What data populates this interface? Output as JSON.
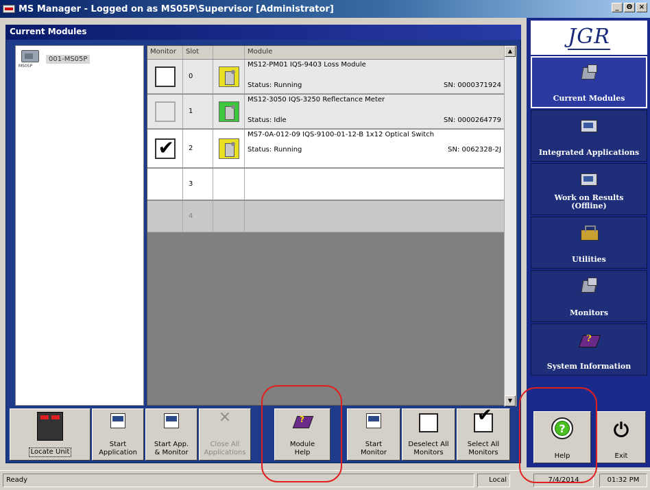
{
  "window": {
    "title": "MS Manager - Logged on as MS05P\\Supervisor [Administrator]",
    "btn_min": "_",
    "btn_max": "Θ",
    "btn_close": "×"
  },
  "panel": {
    "header": "Current Modules"
  },
  "tree": {
    "icon_caption": "MS05P",
    "node_label": "001-MS05P"
  },
  "grid": {
    "columns": [
      "Monitor",
      "Slot",
      "",
      "Module"
    ],
    "rows": [
      {
        "slot": "0",
        "checked": false,
        "module": "MS12-PM01 IQS-9403 Loss Module",
        "status": "Status: Running",
        "sn": "SN: 0000371924",
        "icon": "module-yellow-icon"
      },
      {
        "slot": "1",
        "checked": false,
        "module": "MS12-3050 IQS-3250 Reflectance Meter",
        "status": "Status: Idle",
        "sn": "SN: 0000264779",
        "icon": "module-green-icon"
      },
      {
        "slot": "2",
        "checked": true,
        "module": "MS7-0A-012-09 IQS-9100-01-12-B 1x12 Optical Switch",
        "status": "Status: Running",
        "sn": "SN: 0062328-2J",
        "icon": "module-yellow-icon"
      },
      {
        "slot": "3",
        "checked": false,
        "module": "",
        "status": "",
        "sn": ""
      },
      {
        "slot": "4",
        "checked": false,
        "module": "",
        "status": "",
        "sn": ""
      }
    ],
    "tick": "✔",
    "scroll_up": "▲",
    "scroll_down": "▼"
  },
  "toolbar": {
    "locate_unit": "Locate Unit",
    "start_application_1": "Start",
    "start_application_2": "Application",
    "start_app_monitor_1": "Start App.",
    "start_app_monitor_2": "& Monitor",
    "close_all_1": "Close All",
    "close_all_2": "Applications",
    "module_help_1": "Module",
    "module_help_2": "Help",
    "start_monitor_1": "Start",
    "start_monitor_2": "Monitor",
    "deselect_all_1": "Deselect All",
    "deselect_all_2": "Monitors",
    "select_all_1": "Select All",
    "select_all_2": "Monitors",
    "close_glyph": "×",
    "tick": "✔"
  },
  "sidebar": {
    "logo": "JGR",
    "items": [
      {
        "label": "Current Modules",
        "active": true
      },
      {
        "label": "Integrated Applications"
      },
      {
        "label": "Work on Results (Offline)"
      },
      {
        "label": "Utilities"
      },
      {
        "label": "Monitors"
      },
      {
        "label": "System Information"
      }
    ],
    "help_label": "Help",
    "exit_label": "Exit",
    "help_glyph": "?",
    "power_glyph": "⏻"
  },
  "status": {
    "text": "Ready",
    "location": "Local",
    "date": "7/4/2014",
    "time": "01:32 PM"
  },
  "colors": {
    "highlight": "#e02020",
    "sidebar": "#1a2a8a",
    "header": "#0a1a6a"
  }
}
